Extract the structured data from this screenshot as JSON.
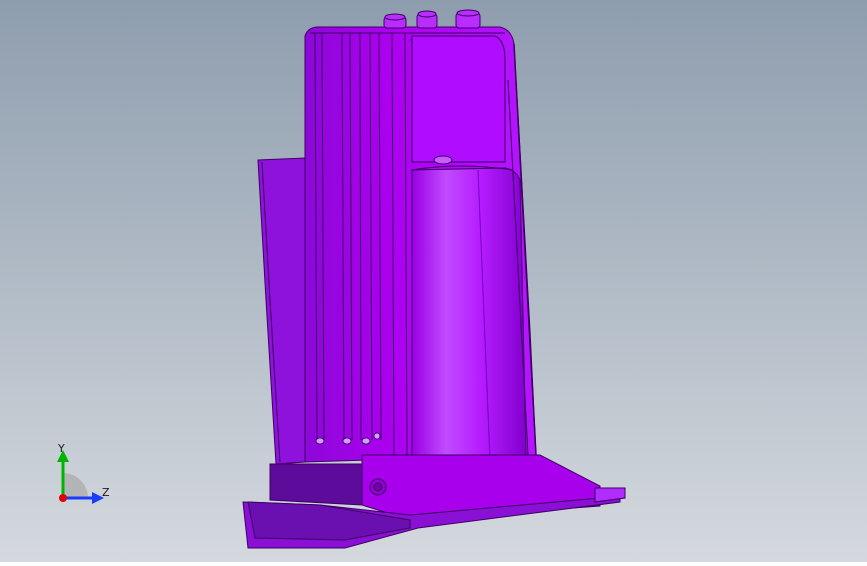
{
  "viewport": {
    "background_top": "#8e9dae",
    "background_bottom": "#d4d9de",
    "model_color": "#aa00ee",
    "model_dark": "#5c0b9a",
    "model_light": "#c64bff",
    "edge_color": "#3d0063"
  },
  "triad": {
    "y_label": "Y",
    "z_label": "Z",
    "y_color": "#00b400",
    "z_color": "#1a3cff",
    "x_color": "#e00000"
  }
}
